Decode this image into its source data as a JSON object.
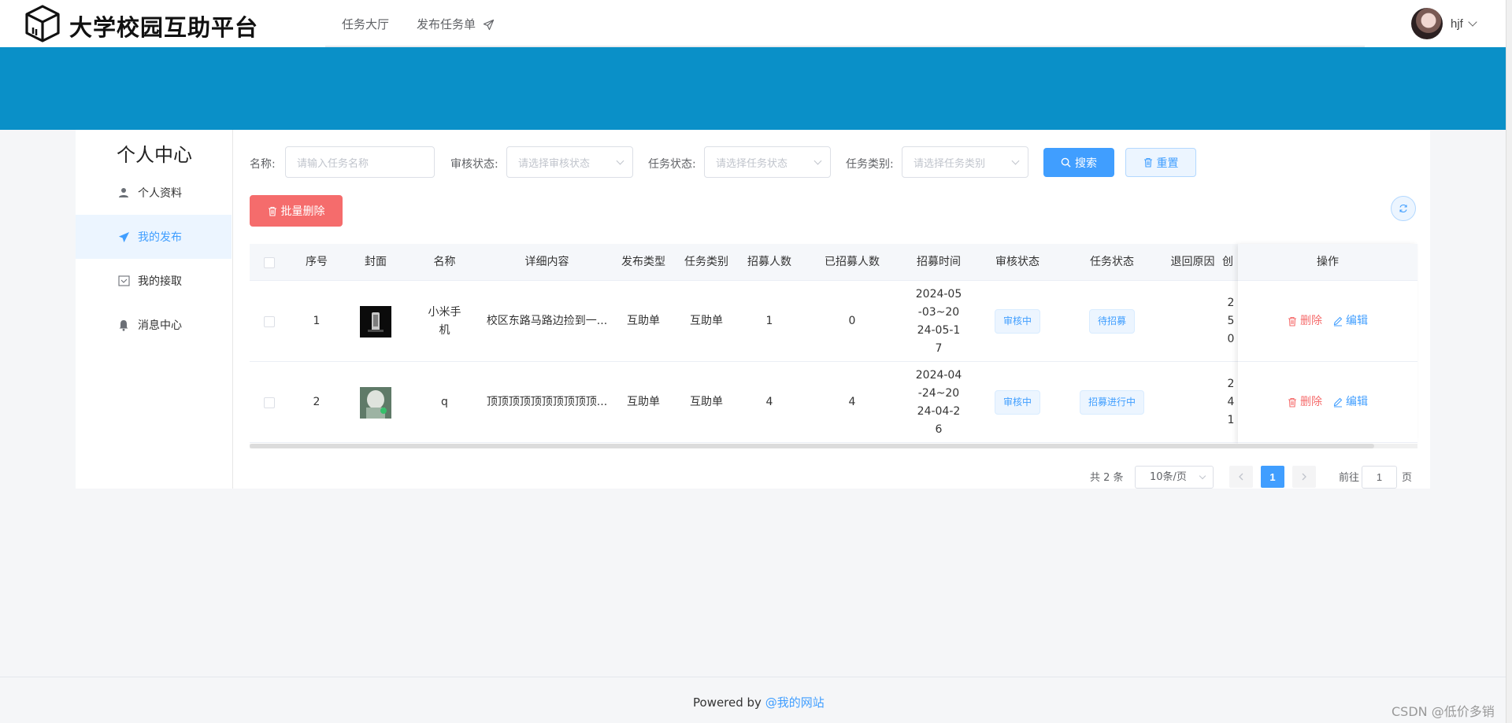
{
  "header": {
    "brand": "大学校园互助平台",
    "nav": [
      {
        "label": "任务大厅"
      },
      {
        "label": "发布任务单"
      }
    ],
    "username": "hjf"
  },
  "sidebar": {
    "title": "个人中心",
    "items": [
      {
        "label": "个人资料",
        "icon": "user-icon"
      },
      {
        "label": "我的发布",
        "icon": "send-icon",
        "active": true
      },
      {
        "label": "我的接取",
        "icon": "inbox-icon"
      },
      {
        "label": "消息中心",
        "icon": "bell-icon"
      }
    ]
  },
  "filters": {
    "name_label": "名称:",
    "name_placeholder": "请输入任务名称",
    "audit_label": "审核状态:",
    "audit_placeholder": "请选择审核状态",
    "task_label": "任务状态:",
    "task_placeholder": "请选择任务状态",
    "category_label": "任务类别:",
    "category_placeholder": "请选择任务类别",
    "search_btn": "搜索",
    "reset_btn": "重置"
  },
  "toolbar": {
    "batch_delete": "批量删除"
  },
  "table": {
    "columns": [
      "序号",
      "封面",
      "名称",
      "详细内容",
      "发布类型",
      "任务类别",
      "招募人数",
      "已招募人数",
      "招募时间",
      "审核状态",
      "任务状态",
      "退回原因",
      "创",
      "操作"
    ],
    "rows": [
      {
        "index": "1",
        "name": "小米手机",
        "detail": "校区东路马路边捡到一...",
        "publish_type": "互助单",
        "category": "互助单",
        "recruit": "1",
        "recruited": "0",
        "time": "2024-05-03~2024-05-17",
        "audit": "审核中",
        "status": "待招募",
        "reason": "",
        "created": "250"
      },
      {
        "index": "2",
        "name": "q",
        "detail": "顶顶顶顶顶顶顶顶顶顶...",
        "publish_type": "互助单",
        "category": "互助单",
        "recruit": "4",
        "recruited": "4",
        "time": "2024-04-24~2024-04-26",
        "audit": "审核中",
        "status": "招募进行中",
        "reason": "",
        "created": "241"
      }
    ],
    "delete_label": "删除",
    "edit_label": "编辑"
  },
  "pagination": {
    "total": "共 2 条",
    "page_size": "10条/页",
    "current": "1",
    "goto_label": "前往",
    "goto_value": "1",
    "page_suffix": "页"
  },
  "footer": {
    "text": "Powered by ",
    "link": "@我的网站"
  },
  "watermark": "CSDN @低价多销",
  "colors": {
    "banner": "#0a90c8",
    "primary": "#409eff",
    "danger": "#f56c6c"
  }
}
